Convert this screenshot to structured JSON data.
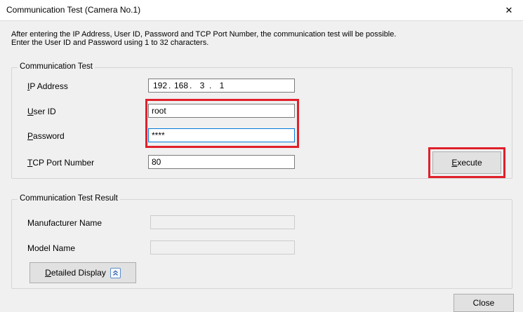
{
  "window": {
    "title": "Communication Test (Camera No.1)",
    "close_glyph": "✕"
  },
  "instructions": {
    "line1": "After entering the IP Address, User ID, Password and TCP Port Number, the communication test will be possible.",
    "line2": "Enter the User ID and Password using 1 to 32 characters."
  },
  "comm_test": {
    "legend": "Communication Test",
    "ip": {
      "label_first": "I",
      "label_rest": "P Address",
      "octets": [
        "192",
        "168",
        "3",
        "1"
      ]
    },
    "user": {
      "label_first": "U",
      "label_rest": "ser ID",
      "value": "root"
    },
    "password": {
      "label_first": "P",
      "label_rest": "assword",
      "value": "****"
    },
    "port": {
      "label_first": "T",
      "label_rest": "CP Port Number",
      "value": "80"
    },
    "execute": {
      "label_first": "E",
      "label_rest": "xecute"
    }
  },
  "result": {
    "legend": "Communication Test Result",
    "manufacturer_label": "Manufacturer Name",
    "manufacturer_value": "",
    "model_label": "Model Name",
    "model_value": "",
    "detailed": {
      "label_first": "D",
      "label_rest": "etailed Display"
    }
  },
  "footer": {
    "close_label": "Close"
  },
  "colors": {
    "highlight": "#e0202a",
    "focus_border": "#0078d7",
    "icon_border": "#5a8ec9"
  },
  "icons": {
    "close": "close-icon",
    "expand": "chevron-double-up-icon"
  }
}
